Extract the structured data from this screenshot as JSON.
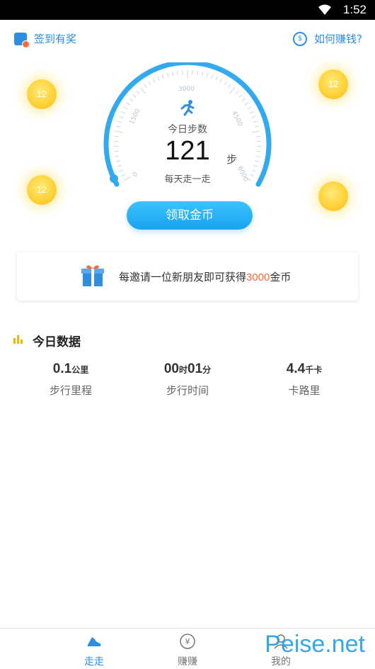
{
  "status_bar": {
    "time": "1:52"
  },
  "top": {
    "checkin_label": "签到有奖",
    "how_earn_label": "如何赚钱?"
  },
  "coins": [
    "12",
    "12",
    "12",
    ""
  ],
  "gauge": {
    "ticks": [
      "0",
      "1500",
      "3000",
      "4500",
      "6000"
    ],
    "steps_label": "今日步数",
    "steps_value": "121",
    "steps_unit": "步",
    "subtitle": "每天走一走",
    "progress": 0.02
  },
  "claim_button": "领取金币",
  "invite": {
    "prefix": "每邀请一位新朋友即可获得",
    "amount": "3000",
    "suffix": "金币"
  },
  "today": {
    "title": "今日数据",
    "stats": [
      {
        "value": "0.1",
        "unit": "公里",
        "label": "步行里程"
      },
      {
        "value_h": "00",
        "unit_h": "时",
        "value_m": "01",
        "unit_m": "分",
        "label": "步行时间"
      },
      {
        "value": "4.4",
        "unit": "千卡",
        "label": "卡路里"
      }
    ]
  },
  "nav": [
    {
      "label": "走走",
      "icon": "shoe-icon",
      "active": true
    },
    {
      "label": "赚赚",
      "icon": "yen-icon",
      "active": false
    },
    {
      "label": "我的",
      "icon": "profile-icon",
      "active": false
    }
  ],
  "watermark": "Peise.net",
  "colors": {
    "accent": "#2f8ee0",
    "button": "#1aa1f0",
    "highlight": "#ff6b2c",
    "coin": "#ffd339"
  }
}
